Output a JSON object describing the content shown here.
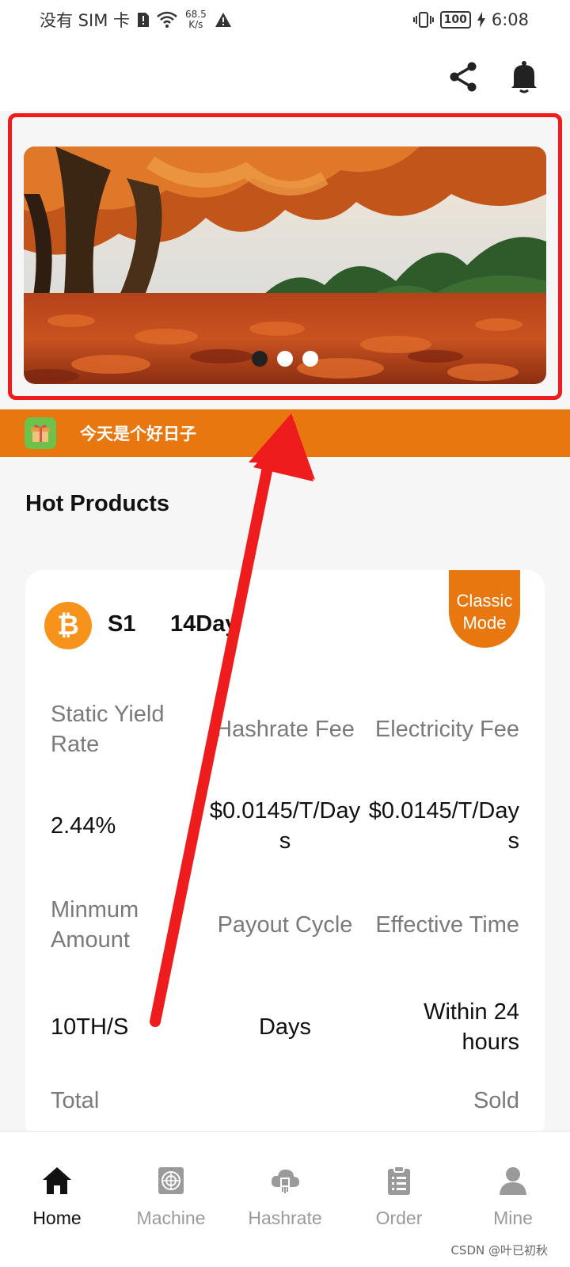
{
  "status_bar": {
    "carrier": "没有 SIM 卡",
    "speed_value": "68.5",
    "speed_unit": "K/s",
    "battery": "100",
    "time": "6:08"
  },
  "header": {
    "share_icon": "share-icon",
    "bell_icon": "bell-icon"
  },
  "banner": {
    "slides": 3,
    "active_index": 0
  },
  "notice": {
    "text": "今天是个好日子"
  },
  "section_title": "Hot Products",
  "product": {
    "name": "S1",
    "period": "14Days",
    "mode_badge_line1": "Classic",
    "mode_badge_line2": "Mode",
    "labels": {
      "static_yield_rate": "Static Yield Rate",
      "hashrate_fee": "Hashrate Fee",
      "electricity_fee": "Electricity Fee",
      "minimum_amount": "Minmum Amount",
      "payout_cycle": "Payout Cycle",
      "effective_time": "Effective Time",
      "total": "Total",
      "sold": "Sold"
    },
    "values": {
      "static_yield_rate": "2.44%",
      "hashrate_fee": "$0.0145/T/Days",
      "electricity_fee": "$0.0145/T/Days",
      "minimum_amount": "10TH/S",
      "payout_cycle": "Days",
      "effective_time": "Within 24 hours"
    }
  },
  "nav": {
    "items": [
      {
        "label": "Home",
        "active": true
      },
      {
        "label": "Machine",
        "active": false
      },
      {
        "label": "Hashrate",
        "active": false
      },
      {
        "label": "Order",
        "active": false
      },
      {
        "label": "Mine",
        "active": false
      }
    ]
  },
  "watermark": "CSDN @叶已初秋",
  "colors": {
    "accent": "#e8770f",
    "annotation": "#ee1c1c",
    "bitcoin": "#f7931a"
  }
}
